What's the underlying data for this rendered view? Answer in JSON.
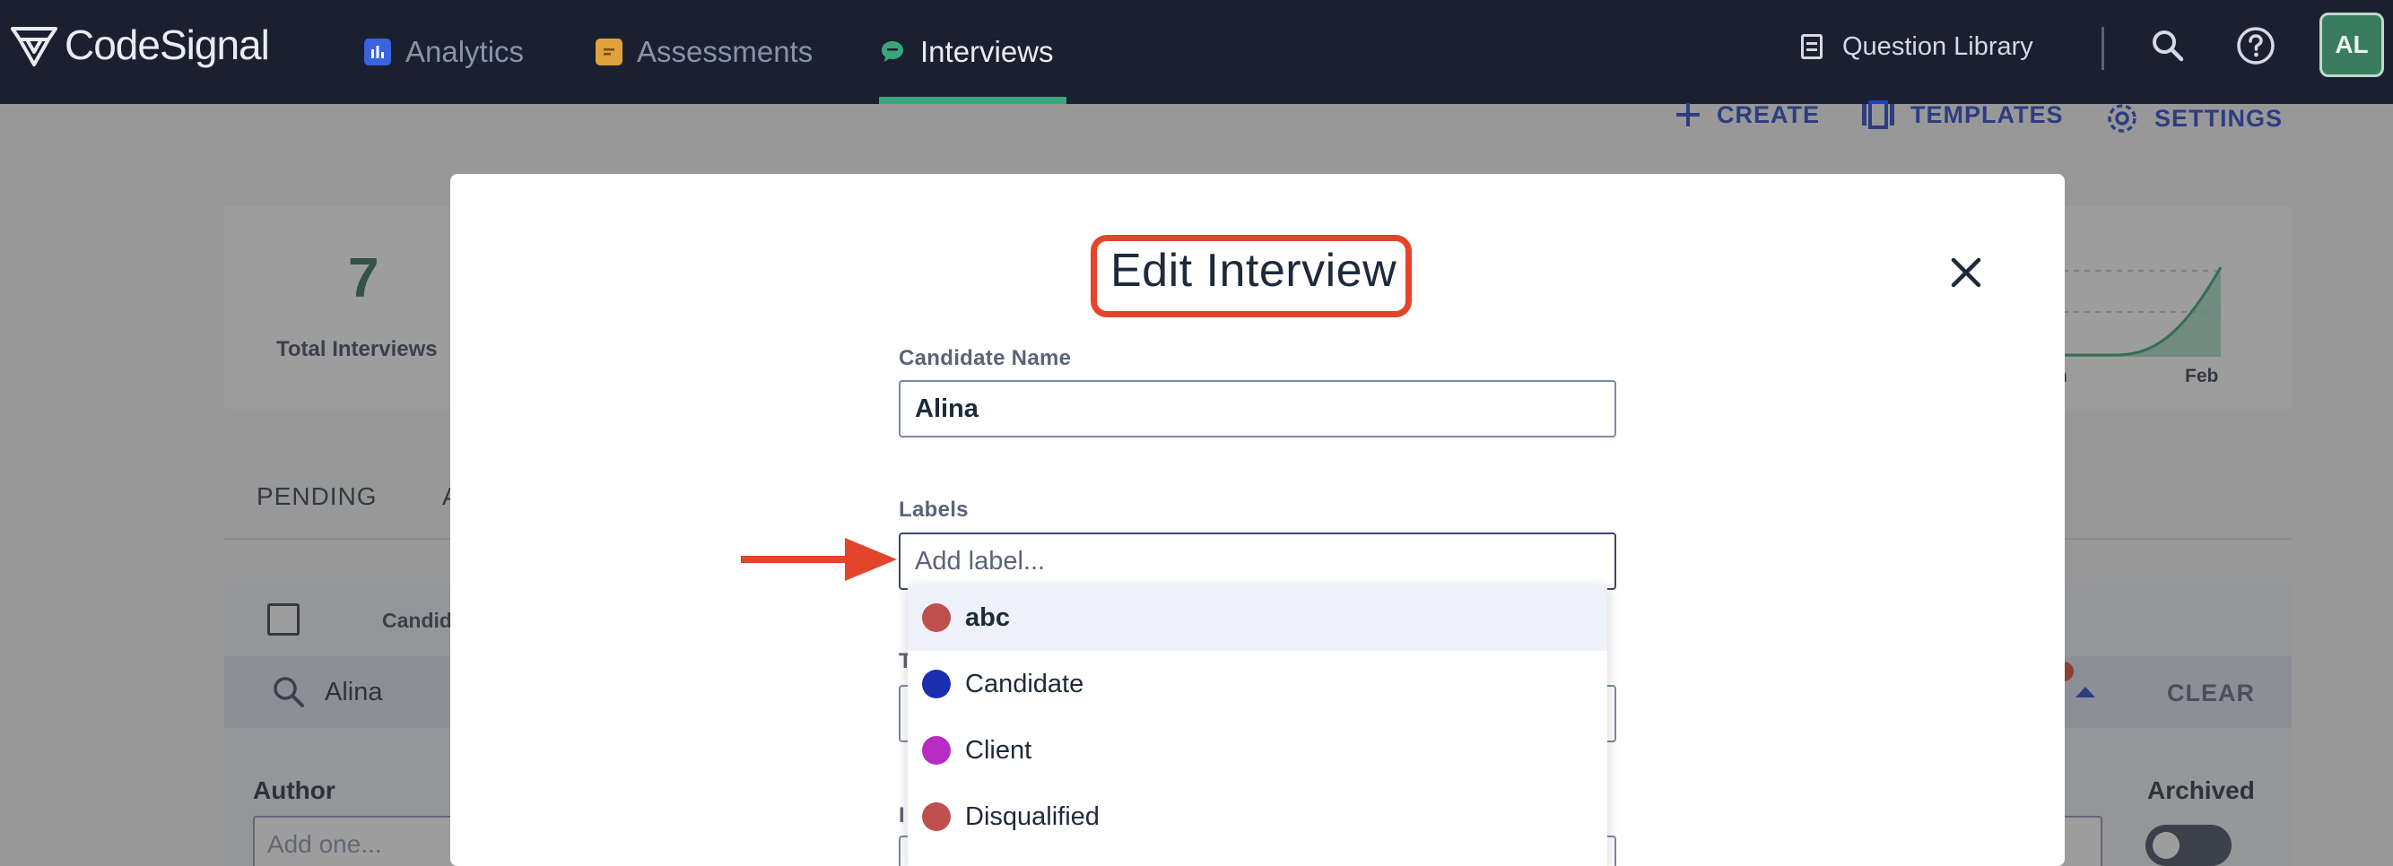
{
  "nav": {
    "logo_text": "CodeSignal",
    "links": [
      {
        "label": "Analytics",
        "icon": "bar-chart-icon",
        "color": "#3a63e0"
      },
      {
        "label": "Assessments",
        "icon": "document-icon",
        "color": "#e0a13a"
      },
      {
        "label": "Interviews",
        "icon": "chat-bubble-icon",
        "color": "#3aa57c"
      }
    ],
    "active_link": "Interviews",
    "question_library": "Question Library",
    "user_initials": "AL"
  },
  "page": {
    "actions": {
      "create": "CREATE",
      "templates": "TEMPLATES",
      "settings": "SETTINGS"
    },
    "stats": {
      "total_value": "7",
      "total_label": "Total Interviews"
    },
    "chart_axis": {
      "left_partial": "n",
      "right": "Feb"
    },
    "tabs": {
      "pending": "PENDING",
      "second_partial": "A"
    },
    "table": {
      "candidate_header_partial": "Candid"
    },
    "search": {
      "value": "Alina",
      "clear": "CLEAR"
    },
    "filters": {
      "author_label": "Author",
      "author_placeholder": "Add one...",
      "archived_label": "Archived"
    }
  },
  "modal": {
    "title": "Edit Interview",
    "candidate_name_label": "Candidate Name",
    "candidate_name_value": "Alina",
    "labels_label": "Labels",
    "labels_placeholder": "Add label...",
    "hidden_label_1_partial": "T",
    "hidden_label_2_partial": "I",
    "label_options": [
      {
        "name": "abc",
        "color": "#c0504d",
        "highlighted": true
      },
      {
        "name": "Candidate",
        "color": "#1a2fb0",
        "highlighted": false
      },
      {
        "name": "Client",
        "color": "#b82bc4",
        "highlighted": false
      },
      {
        "name": "Disqualified",
        "color": "#c0504d",
        "highlighted": false
      }
    ]
  },
  "annotations": {
    "highlight_color": "#e2452a"
  }
}
